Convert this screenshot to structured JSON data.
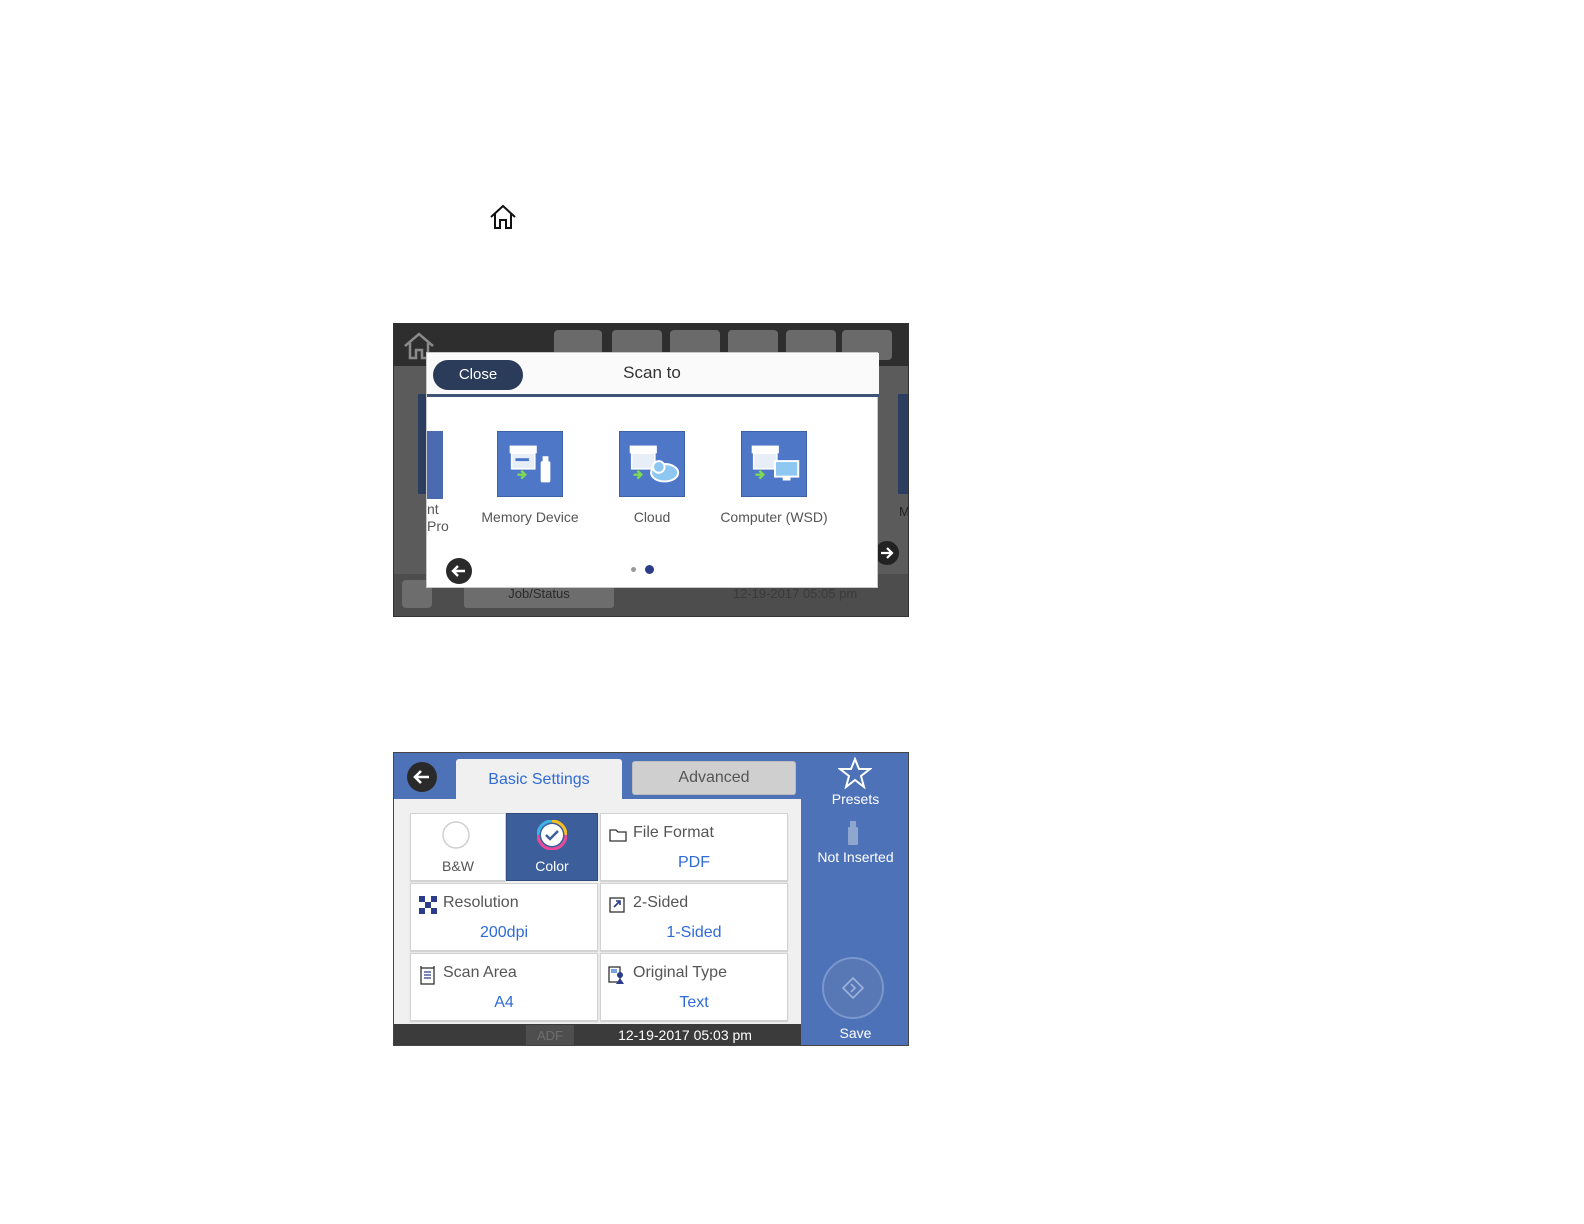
{
  "icons": {
    "home_glyph": "home-icon"
  },
  "scan_to_screen": {
    "background": {
      "job_status_label": "Job/Status",
      "datetime": "12-19-2017 05:05 pm",
      "partial_right_label": "M"
    },
    "dialog": {
      "close_label": "Close",
      "title": "Scan to",
      "partial_left_label": "nt\nPro",
      "destinations": [
        {
          "label": "Memory Device",
          "icon": "memory-device-icon"
        },
        {
          "label": "Cloud",
          "icon": "cloud-icon"
        },
        {
          "label": "Computer (WSD)",
          "icon": "computer-wsd-icon"
        }
      ],
      "page_indicator": {
        "current": 2,
        "total": 2
      }
    }
  },
  "scan_settings_screen": {
    "tabs": [
      {
        "label": "Basic Settings",
        "active": true
      },
      {
        "label": "Advanced",
        "active": false
      }
    ],
    "color_mode": {
      "options": [
        "B&W",
        "Color"
      ],
      "selected": "Color"
    },
    "settings": [
      {
        "title": "File Format",
        "value": "PDF",
        "icon": "folder-icon"
      },
      {
        "title": "Resolution",
        "value": "200dpi",
        "icon": "resolution-icon"
      },
      {
        "title": "2-Sided",
        "value": "1-Sided",
        "icon": "two-sided-icon"
      },
      {
        "title": "Scan Area",
        "value": "A4",
        "icon": "scan-area-icon"
      },
      {
        "title": "Original Type",
        "value": "Text",
        "icon": "original-type-icon"
      }
    ],
    "status_bar": {
      "source": "ADF",
      "datetime": "12-19-2017 05:03 pm"
    },
    "side_panel": {
      "presets_label": "Presets",
      "memory_status": "Not Inserted",
      "save_label": "Save"
    }
  },
  "colors": {
    "accent_blue": "#2f6bd6",
    "panel_blue": "#4d72b8",
    "dialog_navy": "#2b3c5a"
  }
}
